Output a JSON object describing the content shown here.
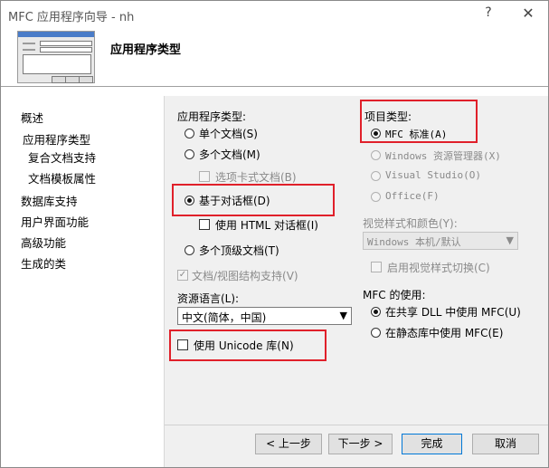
{
  "window": {
    "title": "MFC 应用程序向导 - nh",
    "help": "?",
    "close": "✕"
  },
  "header": {
    "page_title": "应用程序类型"
  },
  "nav": [
    {
      "label": "概述"
    },
    {
      "label": "应用程序类型"
    },
    {
      "label": "复合文档支持"
    },
    {
      "label": "文档模板属性"
    },
    {
      "label": "数据库支持"
    },
    {
      "label": "用户界面功能"
    },
    {
      "label": "高级功能"
    },
    {
      "label": "生成的类"
    }
  ],
  "app_type": {
    "group_label": "应用程序类型:",
    "single_doc": "单个文档(S)",
    "multi_doc": "多个文档(M)",
    "tabbed_docs": "选项卡式文档(B)",
    "dialog_based": "基于对话框(D)",
    "use_html_dialog": "使用 HTML 对话框(I)",
    "multi_top": "多个顶级文档(T)",
    "doc_view": "文档/视图结构支持(V)",
    "resource_lang_label": "资源语言(L):",
    "resource_lang_value": "中文(简体，中国)",
    "use_unicode": "使用 Unicode 库(N)"
  },
  "project_type": {
    "group_label": "项目类型:",
    "mfc_standard": "MFC 标准(A)",
    "windows_explorer": "Windows 资源管理器(X)",
    "visual_studio": "Visual Studio(O)",
    "office": "Office(F)",
    "visual_style_label": "视觉样式和颜色(Y):",
    "visual_style_value": "Windows 本机/默认",
    "enable_visual_switch": "启用视觉样式切换(C)"
  },
  "mfc_use": {
    "group_label": "MFC 的使用:",
    "shared_dll": "在共享 DLL 中使用 MFC(U)",
    "static_lib": "在静态库中使用 MFC(E)"
  },
  "buttons": {
    "back": "< 上一步",
    "next": "下一步 >",
    "finish": "完成",
    "cancel": "取消"
  },
  "colors": {
    "highlight": "#e0202a",
    "accent": "#0078d7"
  }
}
